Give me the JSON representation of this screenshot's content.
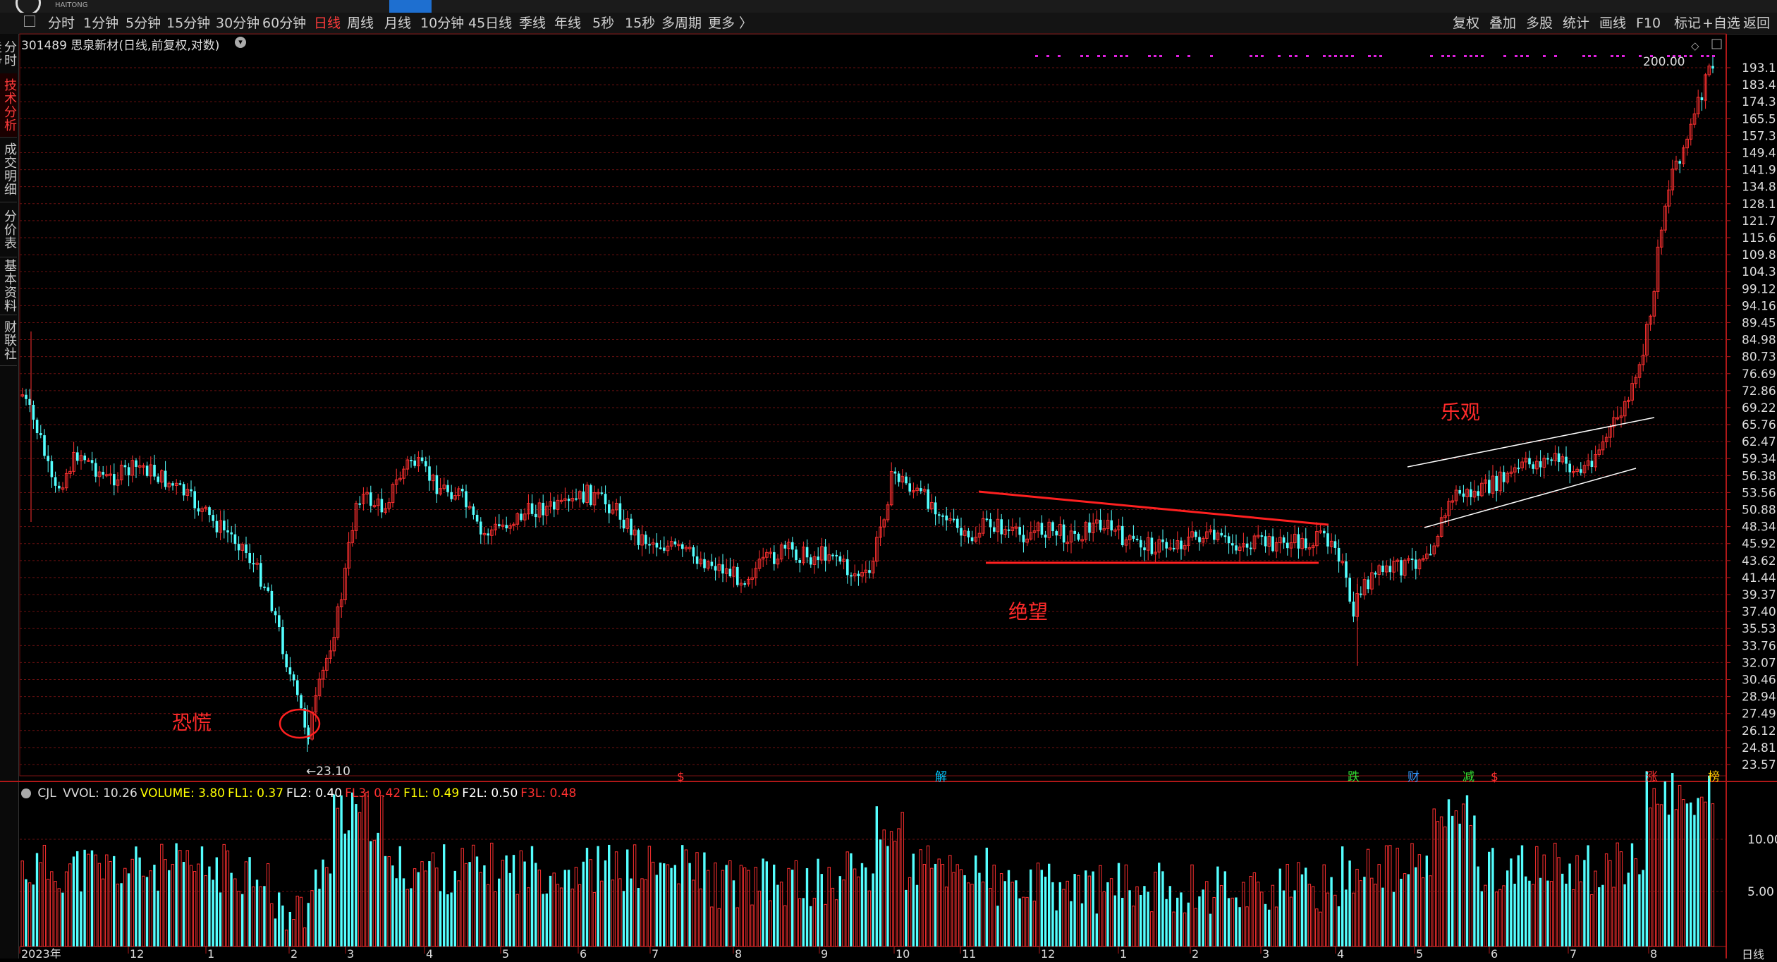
{
  "top_tabs": [
    "",
    "",
    "",
    "",
    "",
    ""
  ],
  "logo_text": "HAITONG",
  "toolbar": {
    "periods": [
      "分时",
      "1分钟",
      "5分钟",
      "15分钟",
      "30分钟",
      "60分钟",
      "日线",
      "周线",
      "月线",
      "10分钟",
      "45日线",
      "季线",
      "年线",
      "5秒",
      "15秒",
      "多周期",
      "更多 〉"
    ],
    "active_period": "日线",
    "right_items": [
      "复权",
      "叠加",
      "多股",
      "统计",
      "画线",
      "F10",
      "标记",
      "+自选",
      "返回"
    ]
  },
  "sidebar": {
    "items": [
      {
        "label": "分时走势",
        "active": false
      },
      {
        "label": "技术分析",
        "active": true
      },
      {
        "label": "成交明细",
        "active": false
      },
      {
        "label": "分价表",
        "active": false
      },
      {
        "label": "基本资料",
        "active": false
      },
      {
        "label": "财联社",
        "active": false
      }
    ]
  },
  "stock": {
    "code": "301489",
    "name": "思泉新材",
    "mode": "(日线,前复权,对数)"
  },
  "price_axis": [
    "193.1",
    "183.4",
    "174.3",
    "165.5",
    "157.3",
    "149.4",
    "141.9",
    "134.8",
    "128.1",
    "121.7",
    "115.6",
    "109.8",
    "104.3",
    "99.12",
    "94.16",
    "89.45",
    "84.98",
    "80.73",
    "76.69",
    "72.86",
    "69.22",
    "65.76",
    "62.47",
    "59.34",
    "56.38",
    "53.56",
    "50.88",
    "48.34",
    "45.92",
    "43.62",
    "41.44",
    "39.37",
    "37.40",
    "35.53",
    "33.76",
    "32.07",
    "30.46",
    "28.94",
    "27.49",
    "26.12",
    "24.81",
    "23.57"
  ],
  "price_labels": {
    "high": "200.00",
    "low": "←23.10"
  },
  "annotations": {
    "panic": "恐慌",
    "despair": "绝望",
    "optimism": "乐观"
  },
  "event_markers": [
    {
      "text": "$",
      "color": "#ff3030"
    },
    {
      "text": "解",
      "color": "#00c8ff"
    },
    {
      "text": "跌",
      "color": "#33dd33"
    },
    {
      "text": "财",
      "color": "#3399ff"
    },
    {
      "text": "减",
      "color": "#33dd33"
    },
    {
      "text": "$",
      "color": "#ff3030"
    },
    {
      "text": "涨",
      "color": "#ff3030"
    },
    {
      "text": "榜",
      "color": "#ffcc00"
    }
  ],
  "indicator": {
    "name": "CJL",
    "items": [
      {
        "label": "VVOL: 10.26",
        "color": "#dddddd"
      },
      {
        "label": "VOLUME: 3.80",
        "color": "#ffff00"
      },
      {
        "label": "FL1: 0.37",
        "color": "#ffff00"
      },
      {
        "label": "FL2: 0.40",
        "color": "#ffffff"
      },
      {
        "label": "FL3: 0.42",
        "color": "#ff3030"
      },
      {
        "label": "F1L: 0.49",
        "color": "#ffff00"
      },
      {
        "label": "F2L: 0.50",
        "color": "#ffffff"
      },
      {
        "label": "F3L: 0.48",
        "color": "#ff3030"
      }
    ]
  },
  "volume_axis": [
    "10.00",
    "5.00"
  ],
  "date_axis": [
    "2023年",
    "12",
    "1",
    "2",
    "3",
    "4",
    "5",
    "6",
    "7",
    "8",
    "9",
    "10",
    "11",
    "12",
    "1",
    "2",
    "3",
    "4",
    "5",
    "6",
    "7",
    "8"
  ],
  "period_label": "日线",
  "colors": {
    "up": "#ff3030",
    "down": "#54ffff",
    "grid": "#6a1010",
    "accent": "#ff3b3b"
  }
}
